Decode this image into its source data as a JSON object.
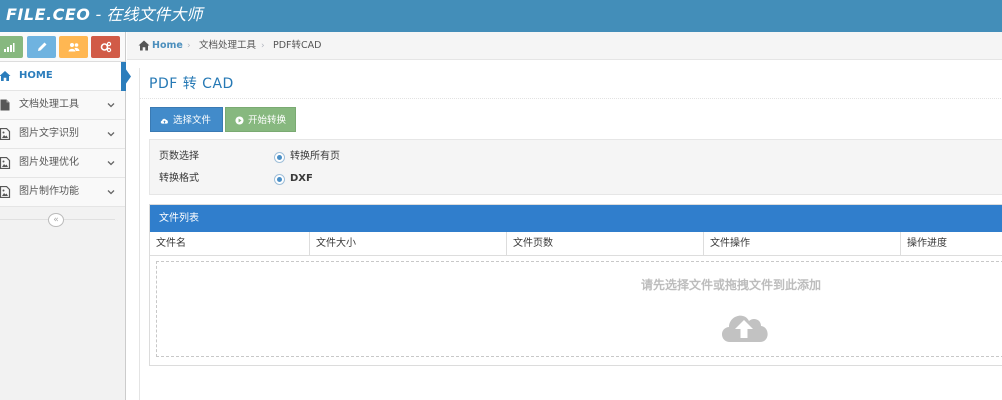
{
  "header": {
    "logo_brand": "FILE.CEO",
    "logo_tagline": "- 在线文件大师"
  },
  "shortcuts": [
    {
      "name": "signal",
      "color": "#87b87f"
    },
    {
      "name": "pencil",
      "color": "#6fb3e0"
    },
    {
      "name": "users",
      "color": "#ffb752"
    },
    {
      "name": "cogs",
      "color": "#d15b47"
    }
  ],
  "sidebar": {
    "items": [
      {
        "label": "HOME",
        "icon": "home-icon",
        "active": true
      },
      {
        "label": "文档处理工具",
        "icon": "file-icon"
      },
      {
        "label": "图片文字识别",
        "icon": "picture-icon"
      },
      {
        "label": "图片处理优化",
        "icon": "picture-icon"
      },
      {
        "label": "图片制作功能",
        "icon": "picture-icon"
      }
    ],
    "collapse_glyph": "«"
  },
  "breadcrumbs": {
    "home": "Home",
    "category": "文档处理工具",
    "current": "PDF转CAD"
  },
  "page": {
    "title": "PDF 转 CAD",
    "select_button": "选择文件",
    "convert_button": "开始转换",
    "options": [
      {
        "label": "页数选择",
        "value": "转换所有页"
      },
      {
        "label": "转换格式",
        "value": "DXF"
      }
    ],
    "file_list": {
      "heading": "文件列表",
      "columns": [
        "文件名",
        "文件大小",
        "文件页数",
        "文件操作",
        "操作进度"
      ],
      "empty_hint": "请先选择文件或拖拽文件到此添加"
    }
  },
  "colors": {
    "topbar": "#438eb9",
    "accent": "#2b7dbc",
    "list_header": "#307ecc",
    "btn_primary": "#428bca",
    "btn_success": "#87b87f"
  }
}
